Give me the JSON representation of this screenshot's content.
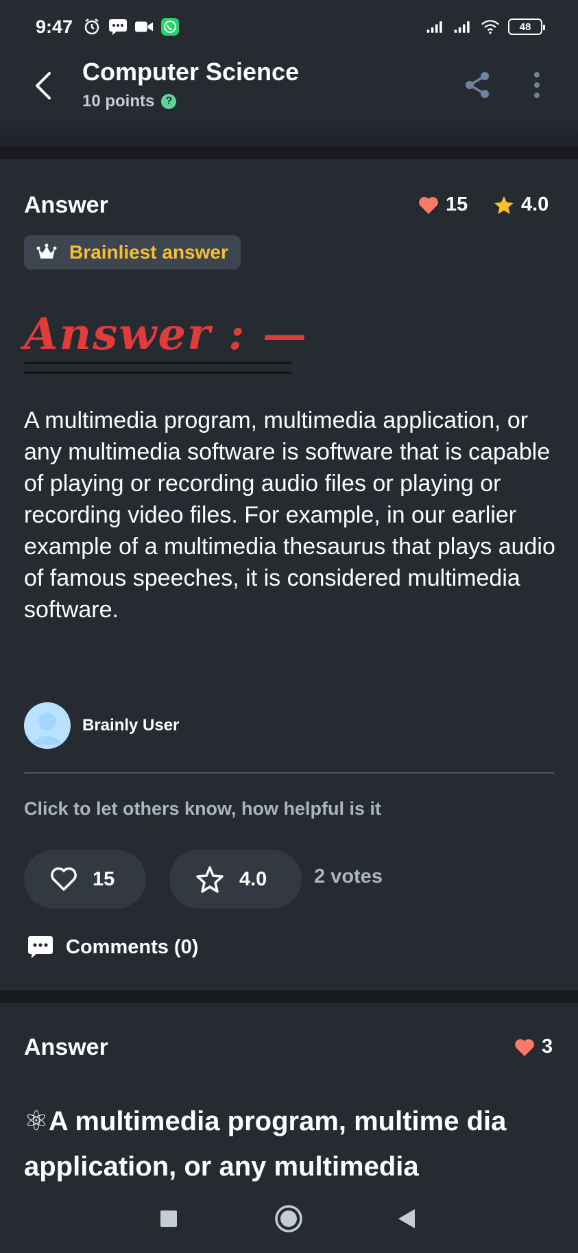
{
  "status_bar": {
    "time": "9:47",
    "battery": "48",
    "icons": [
      "alarm-icon",
      "message-icon",
      "video-icon",
      "whatsapp-icon",
      "signal-icon",
      "signal-icon",
      "wifi-icon",
      "battery-icon"
    ]
  },
  "header": {
    "title": "Computer Science",
    "points": "10 points",
    "help_glyph": "?"
  },
  "answer1": {
    "heading": "Answer",
    "likes": "15",
    "rating": "4.0",
    "badge": "Brainliest answer",
    "gothic_title": "Answer : —",
    "body": "A multimedia program, multimedia application, or any multimedia software is software that is capable of playing or recording audio files or playing or recording video files. For example, in our earlier example of a multimedia thesaurus that plays audio of famous speeches, it is considered multimedia software.",
    "user": "Brainly User",
    "helpful_prompt": "Click to let others know, how helpful is it",
    "vote_likes": "15",
    "vote_rating": "4.0",
    "votes": "2 votes",
    "comments": "Comments (0)"
  },
  "answer2": {
    "heading": "Answer",
    "likes": "3",
    "body": "⚛A multimedia program, multime dia application, or any multimedia"
  },
  "colors": {
    "background": "#262a31",
    "heart": "#ff7968",
    "star": "#fbbe2e",
    "badge_text": "#fbbe2e",
    "gothic_red": "#e23b3b",
    "help_green": "#60d399"
  }
}
